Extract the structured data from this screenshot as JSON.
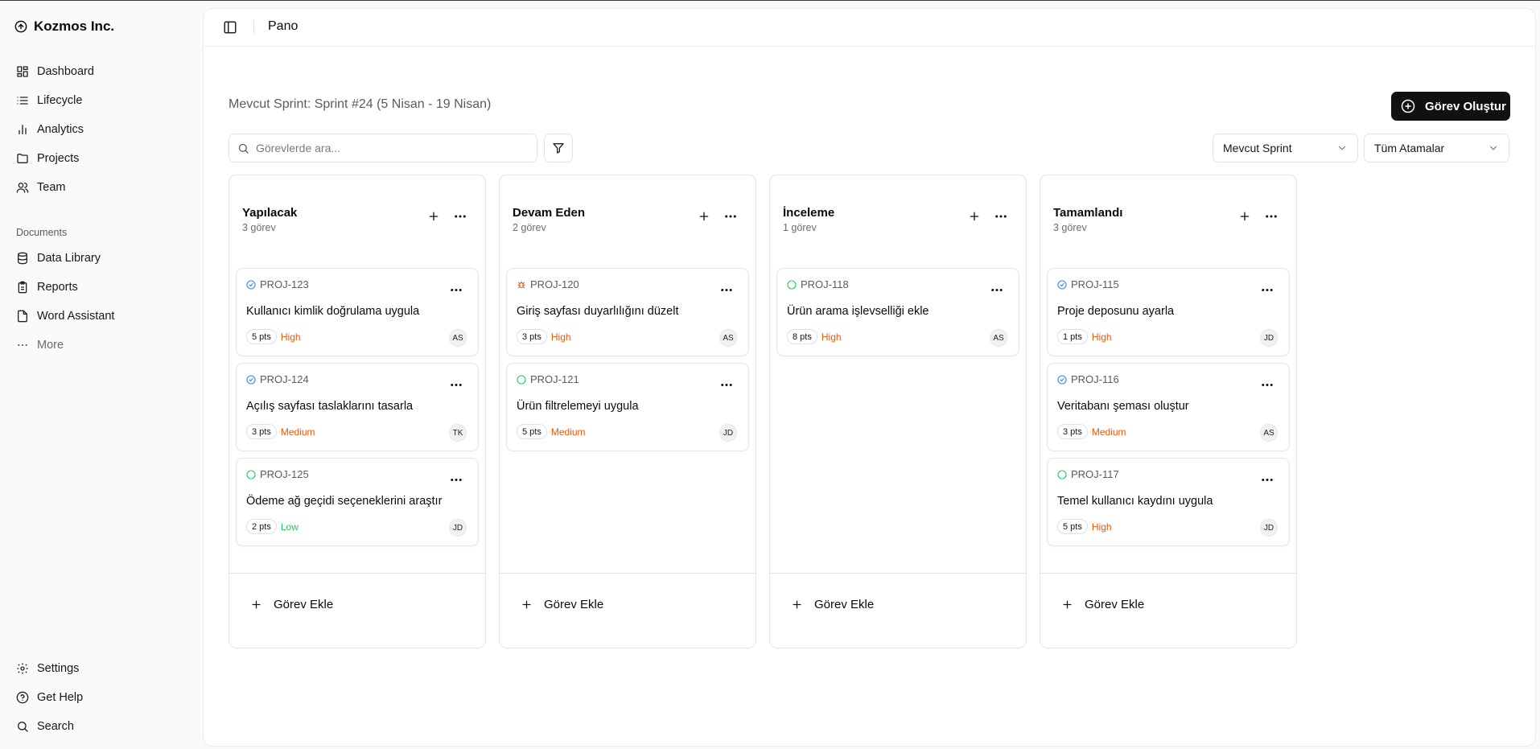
{
  "sidebar": {
    "brand": "Kozmos Inc.",
    "nav": [
      {
        "label": "Dashboard",
        "icon": "dashboard-icon"
      },
      {
        "label": "Lifecycle",
        "icon": "list-icon"
      },
      {
        "label": "Analytics",
        "icon": "bar-chart-icon"
      },
      {
        "label": "Projects",
        "icon": "folder-icon"
      },
      {
        "label": "Team",
        "icon": "users-icon"
      }
    ],
    "documents_label": "Documents",
    "documents": [
      {
        "label": "Data Library",
        "icon": "database-icon"
      },
      {
        "label": "Reports",
        "icon": "clipboard-icon"
      },
      {
        "label": "Word Assistant",
        "icon": "file-icon"
      },
      {
        "label": "More",
        "icon": "ellipsis-icon"
      }
    ],
    "footer": [
      {
        "label": "Settings",
        "icon": "gear-icon"
      },
      {
        "label": "Get Help",
        "icon": "help-circle-icon"
      },
      {
        "label": "Search",
        "icon": "search-icon"
      }
    ]
  },
  "header": {
    "title": "Pano"
  },
  "toolbar": {
    "sprint_label": "Mevcut Sprint: Sprint #24 (5 Nisan - 19 Nisan)",
    "create_label": "Görev Oluştur",
    "search_placeholder": "Görevlerde ara...",
    "sprint_select": "Mevcut Sprint",
    "assignee_select": "Tüm Atamalar"
  },
  "board": {
    "add_task_label": "Görev Ekle",
    "columns": [
      {
        "title": "Yapılacak",
        "count": "3 görev",
        "cards": [
          {
            "id": "PROJ-123",
            "status_icon": "circle-check-icon",
            "status_color": "#3b82f6",
            "title": "Kullanıcı kimlik doğrulama uygula",
            "points": "5 pts",
            "priority": "High",
            "priority_color": "#ea580c",
            "assignee": "AS"
          },
          {
            "id": "PROJ-124",
            "status_icon": "circle-check-icon",
            "status_color": "#3b82f6",
            "title": "Açılış sayfası taslaklarını tasarla",
            "points": "3 pts",
            "priority": "Medium",
            "priority_color": "#ea580c",
            "assignee": "TK"
          },
          {
            "id": "PROJ-125",
            "status_icon": "circle-icon",
            "status_color": "#22c55e",
            "title": "Ödeme ağ geçidi seçeneklerini araştır",
            "points": "2 pts",
            "priority": "Low",
            "priority_color": "#22c55e",
            "assignee": "JD"
          }
        ]
      },
      {
        "title": "Devam Eden",
        "count": "2 görev",
        "cards": [
          {
            "id": "PROJ-120",
            "status_icon": "bug-icon",
            "status_color": "#ea580c",
            "title": "Giriş sayfası duyarlılığını düzelt",
            "points": "3 pts",
            "priority": "High",
            "priority_color": "#ea580c",
            "assignee": "AS"
          },
          {
            "id": "PROJ-121",
            "status_icon": "circle-icon",
            "status_color": "#22c55e",
            "title": "Ürün filtrelemeyi uygula",
            "points": "5 pts",
            "priority": "Medium",
            "priority_color": "#ea580c",
            "assignee": "JD"
          }
        ]
      },
      {
        "title": "İnceleme",
        "count": "1 görev",
        "cards": [
          {
            "id": "PROJ-118",
            "status_icon": "circle-icon",
            "status_color": "#22c55e",
            "title": "Ürün arama işlevselliği ekle",
            "points": "8 pts",
            "priority": "High",
            "priority_color": "#ea580c",
            "assignee": "AS"
          }
        ]
      },
      {
        "title": "Tamamlandı",
        "count": "3 görev",
        "cards": [
          {
            "id": "PROJ-115",
            "status_icon": "circle-check-icon",
            "status_color": "#3b82f6",
            "title": "Proje deposunu ayarla",
            "points": "1 pts",
            "priority": "High",
            "priority_color": "#ea580c",
            "assignee": "JD"
          },
          {
            "id": "PROJ-116",
            "status_icon": "circle-check-icon",
            "status_color": "#3b82f6",
            "title": "Veritabanı şeması oluştur",
            "points": "3 pts",
            "priority": "Medium",
            "priority_color": "#ea580c",
            "assignee": "AS"
          },
          {
            "id": "PROJ-117",
            "status_icon": "circle-icon",
            "status_color": "#22c55e",
            "title": "Temel kullanıcı kaydını uygula",
            "points": "5 pts",
            "priority": "High",
            "priority_color": "#ea580c",
            "assignee": "JD"
          }
        ]
      }
    ]
  }
}
